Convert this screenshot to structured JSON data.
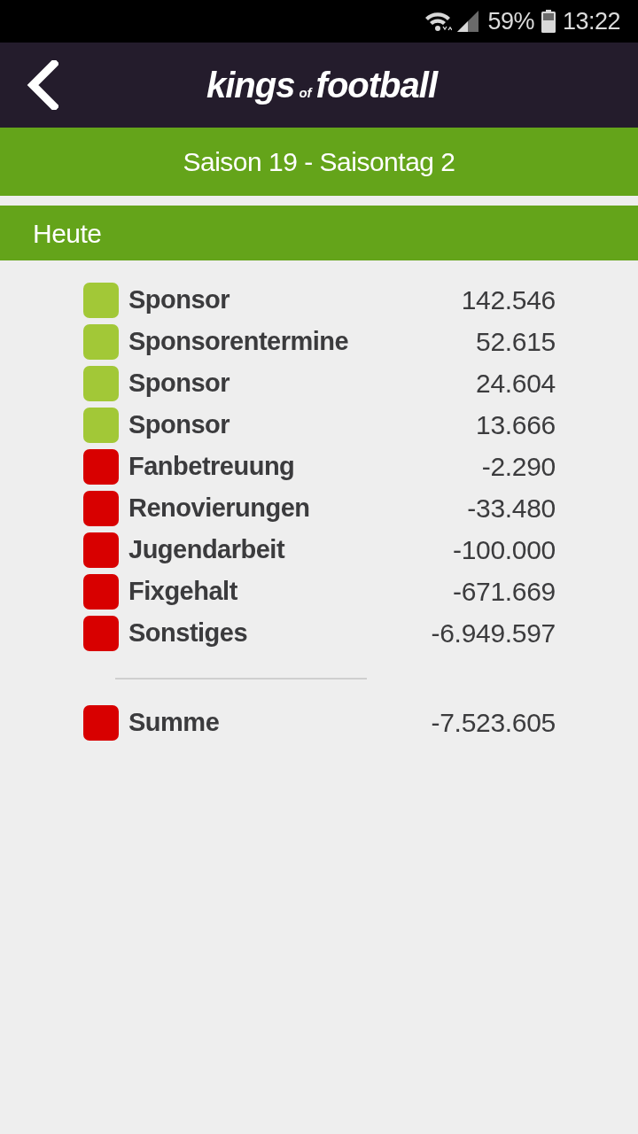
{
  "status_bar": {
    "battery": "59%",
    "time": "13:22"
  },
  "header": {
    "logo": {
      "before": "kings",
      "middle": "of",
      "after": "football"
    }
  },
  "season_bar": {
    "title": "Saison 19 - Saisontag 2"
  },
  "section": {
    "title": "Heute"
  },
  "entries": [
    {
      "label": "Sponsor",
      "value": "142.546",
      "color": "#a2c837"
    },
    {
      "label": "Sponsorentermine",
      "value": "52.615",
      "color": "#a2c837"
    },
    {
      "label": "Sponsor",
      "value": "24.604",
      "color": "#a2c837"
    },
    {
      "label": "Sponsor",
      "value": "13.666",
      "color": "#a2c837"
    },
    {
      "label": "Fanbetreuung",
      "value": "-2.290",
      "color": "#d80000"
    },
    {
      "label": "Renovierungen",
      "value": "-33.480",
      "color": "#d80000"
    },
    {
      "label": "Jugendarbeit",
      "value": "-100.000",
      "color": "#d80000"
    },
    {
      "label": "Fixgehalt",
      "value": "-671.669",
      "color": "#d80000"
    },
    {
      "label": "Sonstiges",
      "value": "-6.949.597",
      "color": "#d80000"
    }
  ],
  "total": {
    "label": "Summe",
    "value": "-7.523.605",
    "color": "#d80000"
  }
}
